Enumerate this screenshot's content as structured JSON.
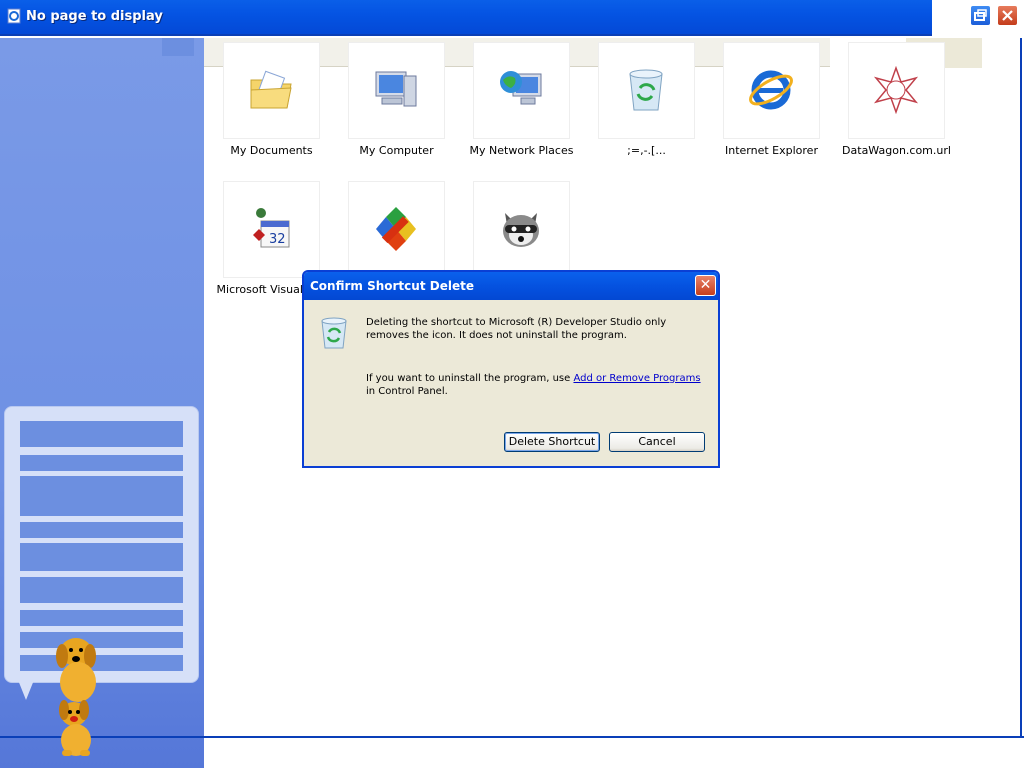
{
  "window": {
    "title": "No page to display",
    "icons": {
      "title": "ie-page-icon",
      "restore": "restore-icon",
      "close": "close-icon"
    }
  },
  "desktop_items": [
    {
      "label": "My Documents",
      "icon": "my-documents-icon"
    },
    {
      "label": "My Computer",
      "icon": "my-computer-icon"
    },
    {
      "label": "My Network Places",
      "icon": "network-places-icon"
    },
    {
      "label": ";=,-.[...",
      "icon": "recycle-bin-icon"
    },
    {
      "label": "Internet Explorer",
      "icon": "internet-explorer-icon"
    },
    {
      "label": "DataWagon.com.url",
      "icon": "datawagon-star-icon"
    },
    {
      "label": "Microsoft Visual Bas",
      "icon": "visual-basic-calendar-icon"
    },
    {
      "label": "",
      "icon": "developer-studio-icon"
    },
    {
      "label": "",
      "icon": "raccoon-icon"
    }
  ],
  "dialog": {
    "title": "Confirm Shortcut Delete",
    "close_glyph": "✕",
    "message1": "Deleting the shortcut to Microsoft (R) Developer Studio only removes the icon. It does not uninstall the program.",
    "message2_prefix": "If you want to uninstall the program, use ",
    "message2_link": "Add or Remove Programs",
    "message2_suffix": " in Control Panel.",
    "delete_button": "Delete Shortcut",
    "cancel_button": "Cancel"
  },
  "colors": {
    "title_bar": "#0554e3",
    "left_pane": "#7a9ae7",
    "dialog_bg": "#ece9d8"
  }
}
